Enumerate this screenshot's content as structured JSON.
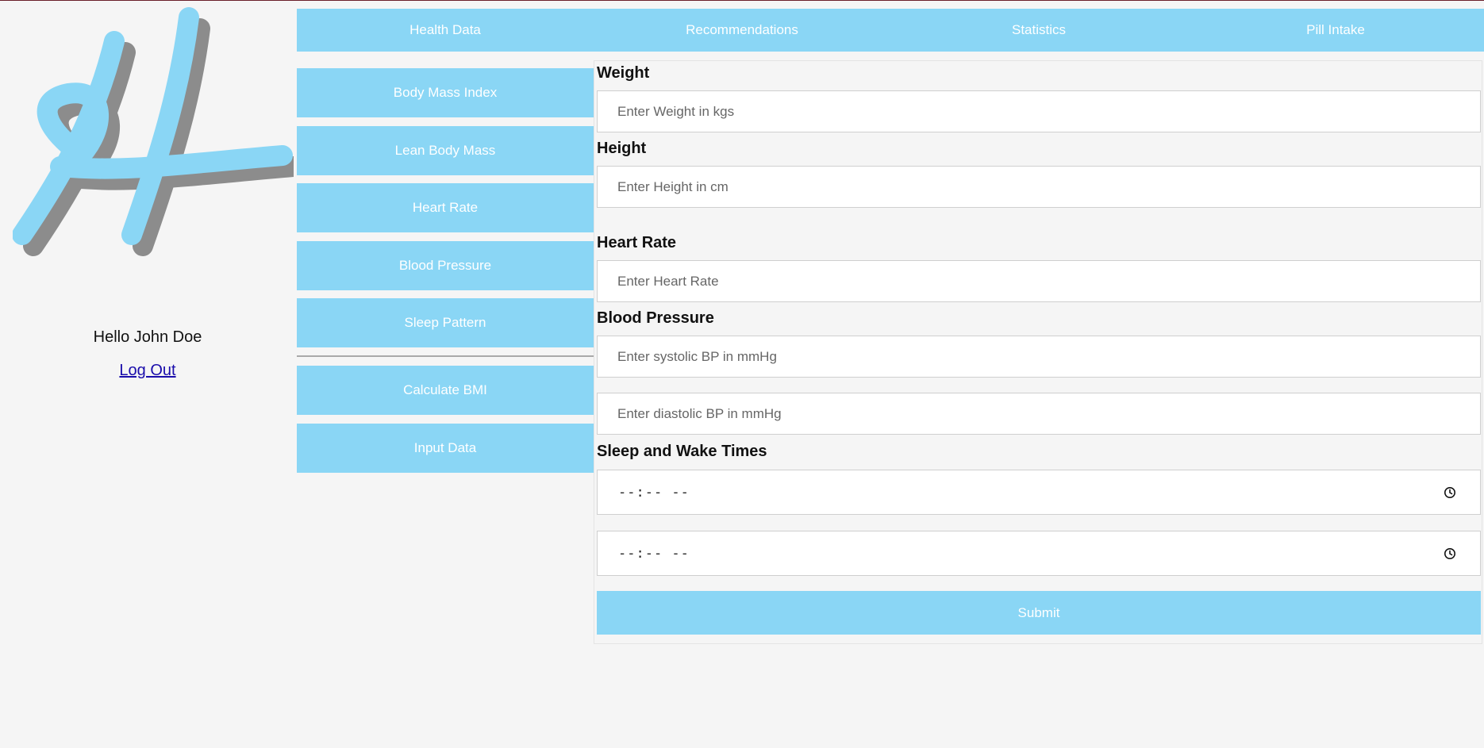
{
  "user": {
    "greeting": "Hello John Doe",
    "logout_label": "Log Out"
  },
  "logo": {
    "letter": "H",
    "accent_color": "#8ad6f5",
    "shadow_color": "#8c8c8c"
  },
  "topnav": [
    {
      "label": "Health Data"
    },
    {
      "label": "Recommendations"
    },
    {
      "label": "Statistics"
    },
    {
      "label": "Pill Intake"
    }
  ],
  "sidemenu": {
    "items": [
      {
        "label": "Body Mass Index"
      },
      {
        "label": "Lean Body Mass"
      },
      {
        "label": "Heart Rate"
      },
      {
        "label": "Blood Pressure"
      },
      {
        "label": "Sleep Pattern"
      }
    ],
    "actions": [
      {
        "label": "Calculate BMI"
      },
      {
        "label": "Input Data"
      }
    ]
  },
  "form": {
    "weight": {
      "label": "Weight",
      "placeholder": "Enter Weight in kgs"
    },
    "height": {
      "label": "Height",
      "placeholder": "Enter Height in cm"
    },
    "heart_rate": {
      "label": "Heart Rate",
      "placeholder": "Enter Heart Rate"
    },
    "blood_pressure": {
      "label": "Blood Pressure",
      "systolic_placeholder": "Enter systolic BP in mmHg",
      "diastolic_placeholder": "Enter diastolic BP in mmHg"
    },
    "sleep": {
      "label": "Sleep and Wake Times",
      "sleep_time": "--:-- --",
      "wake_time": "--:-- --"
    },
    "submit_label": "Submit"
  },
  "colors": {
    "accent": "#8ad6f5",
    "background": "#f5f5f5",
    "link": "#1a0dab"
  }
}
